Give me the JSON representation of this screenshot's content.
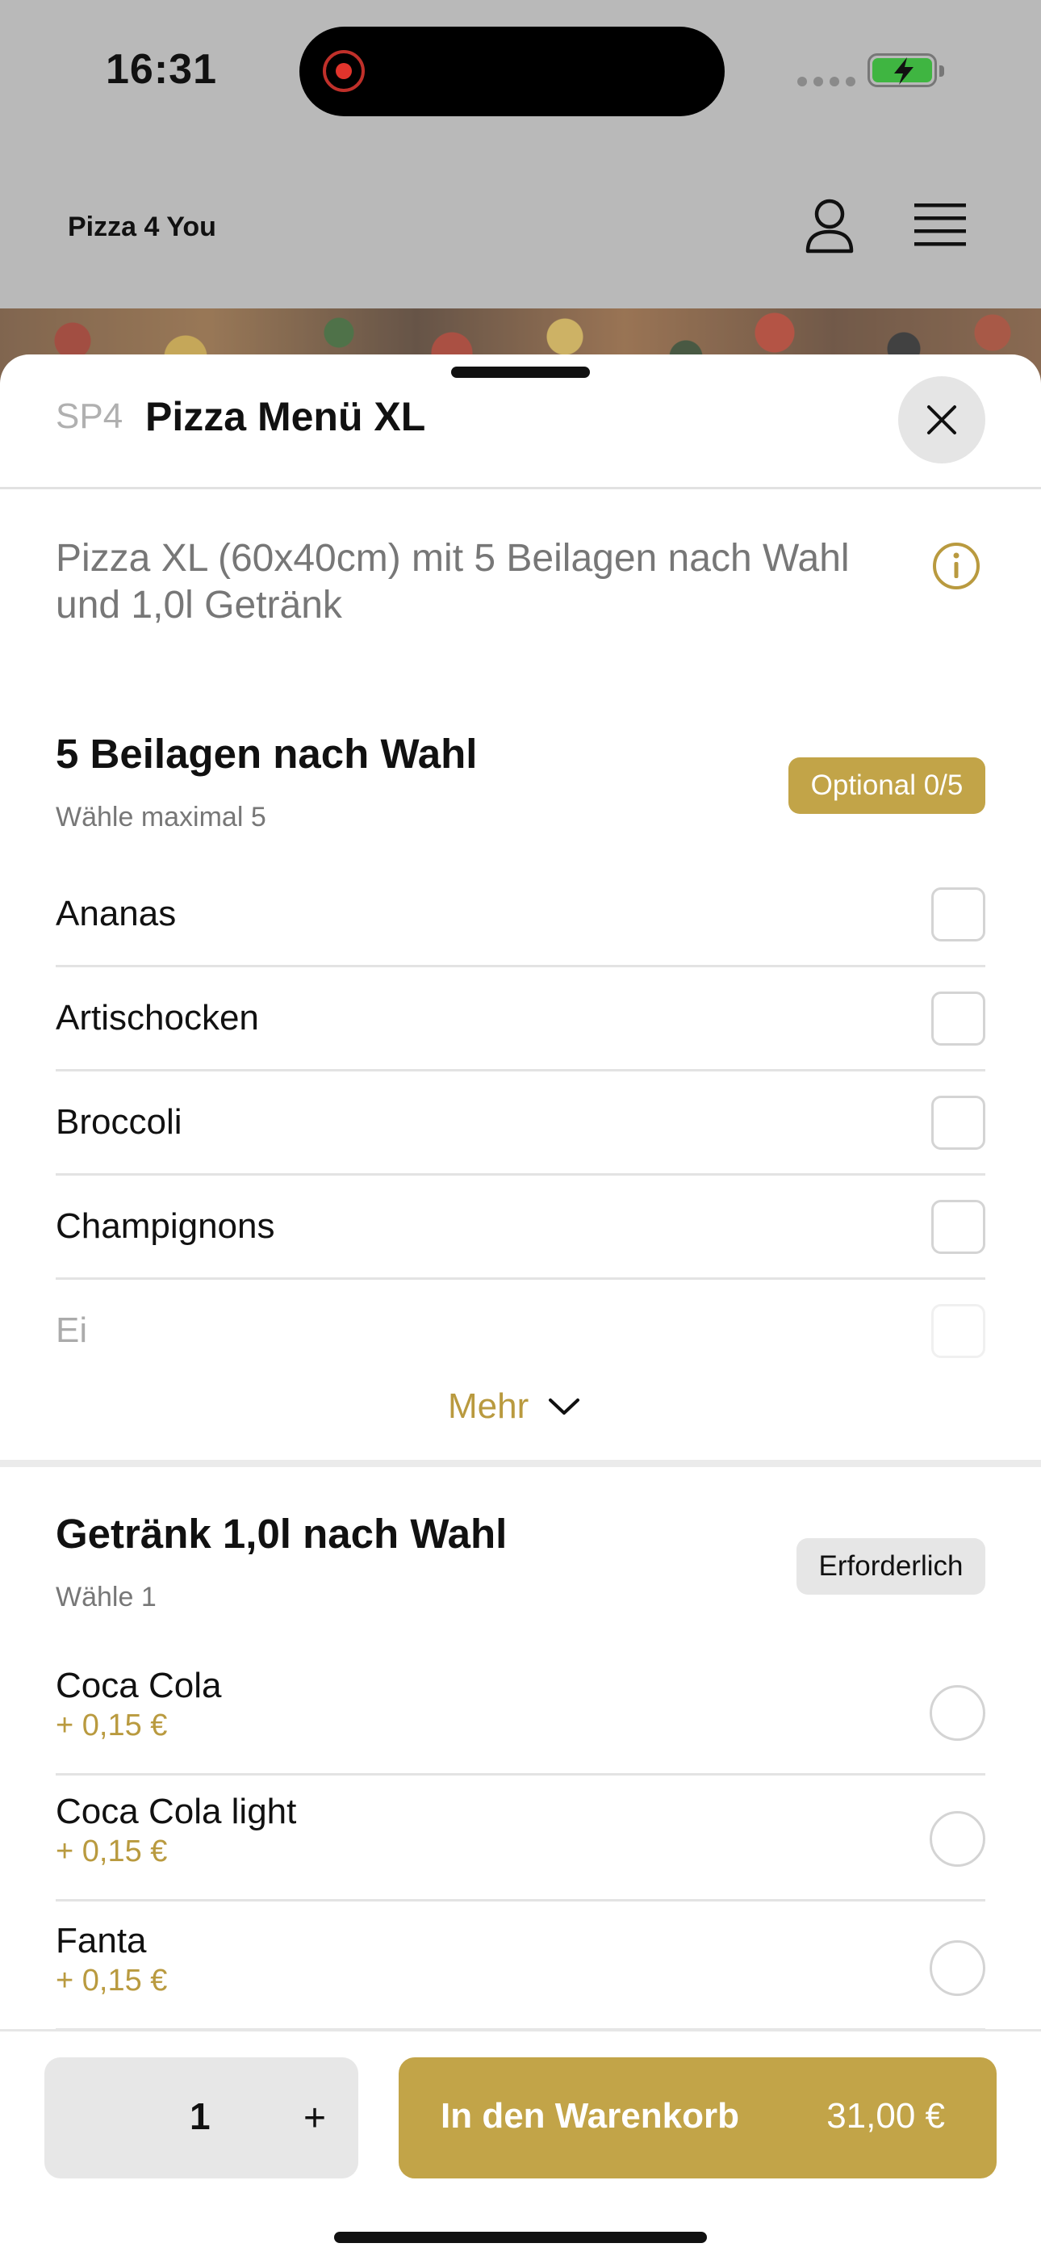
{
  "status_bar": {
    "time": "16:31"
  },
  "header": {
    "brand": "Pizza 4 You"
  },
  "product": {
    "code": "SP4",
    "title": "Pizza Menü XL",
    "description": "Pizza XL (60x40cm) mit 5 Beilagen nach Wahl und 1,0l Getränk"
  },
  "toppings": {
    "title": "5 Beilagen nach Wahl",
    "subtitle": "Wähle maximal 5",
    "badge": "Optional 0/5",
    "items": [
      {
        "label": "Ananas",
        "checked": false
      },
      {
        "label": "Artischocken",
        "checked": false
      },
      {
        "label": "Broccoli",
        "checked": false
      },
      {
        "label": "Champignons",
        "checked": false
      },
      {
        "label": "Ei",
        "checked": false
      }
    ],
    "more_label": "Mehr"
  },
  "drinks": {
    "title": "Getränk 1,0l nach Wahl",
    "subtitle": "Wähle 1",
    "badge": "Erforderlich",
    "items": [
      {
        "label": "Coca Cola",
        "price": "+ 0,15 €",
        "selected": false
      },
      {
        "label": "Coca Cola light",
        "price": "+ 0,15 €",
        "selected": false
      },
      {
        "label": "Fanta",
        "price": "+ 0,15 €",
        "selected": false
      }
    ]
  },
  "bottom_bar": {
    "quantity": "1",
    "plus_label": "+",
    "add_to_cart_label": "In den Warenkorb",
    "total_price": "31,00 €"
  },
  "colors": {
    "accent": "#c2a448",
    "accent_text": "#b99a3f",
    "scrim": "#b9b9b9"
  },
  "icons": [
    "user-icon",
    "menu-icon",
    "close-icon",
    "info-icon",
    "chevron-down-icon",
    "battery-icon",
    "screen-recording-icon"
  ]
}
